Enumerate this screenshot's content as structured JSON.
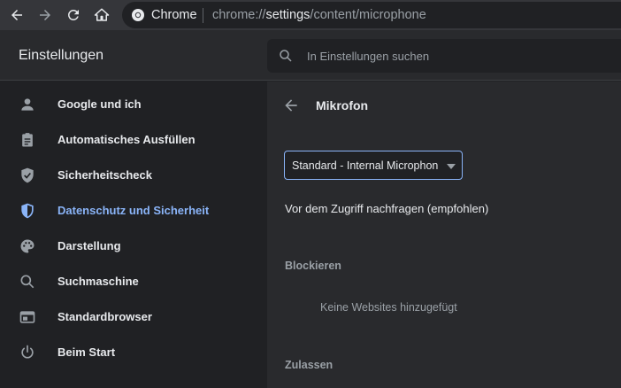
{
  "browser": {
    "site_name": "Chrome",
    "url_scheme": "chrome://",
    "url_host": "settings",
    "url_path": "/content/microphone"
  },
  "header": {
    "title": "Einstellungen",
    "search_placeholder": "In Einstellungen suchen"
  },
  "sidebar": {
    "items": [
      {
        "label": "Google und ich",
        "icon": "person-icon"
      },
      {
        "label": "Automatisches Ausfüllen",
        "icon": "clipboard-icon"
      },
      {
        "label": "Sicherheitscheck",
        "icon": "shield-check-icon"
      },
      {
        "label": "Datenschutz und Sicherheit",
        "icon": "shield-icon",
        "active": true
      },
      {
        "label": "Darstellung",
        "icon": "palette-icon"
      },
      {
        "label": "Suchmaschine",
        "icon": "search-icon"
      },
      {
        "label": "Standardbrowser",
        "icon": "browser-window-icon"
      },
      {
        "label": "Beim Start",
        "icon": "power-icon"
      }
    ]
  },
  "main": {
    "title": "Mikrofon",
    "device_select_value": "Standard - Internal Microphon",
    "ask_label": "Vor dem Zugriff nachfragen (empfohlen)",
    "block_heading": "Blockieren",
    "block_empty": "Keine Websites hinzugefügt",
    "allow_heading": "Zulassen"
  },
  "colors": {
    "accent": "#8ab4f8",
    "text": "#e8eaed",
    "secondary_text": "#9aa0a6",
    "sidebar_bg": "#202124",
    "content_bg": "#292a2d"
  }
}
